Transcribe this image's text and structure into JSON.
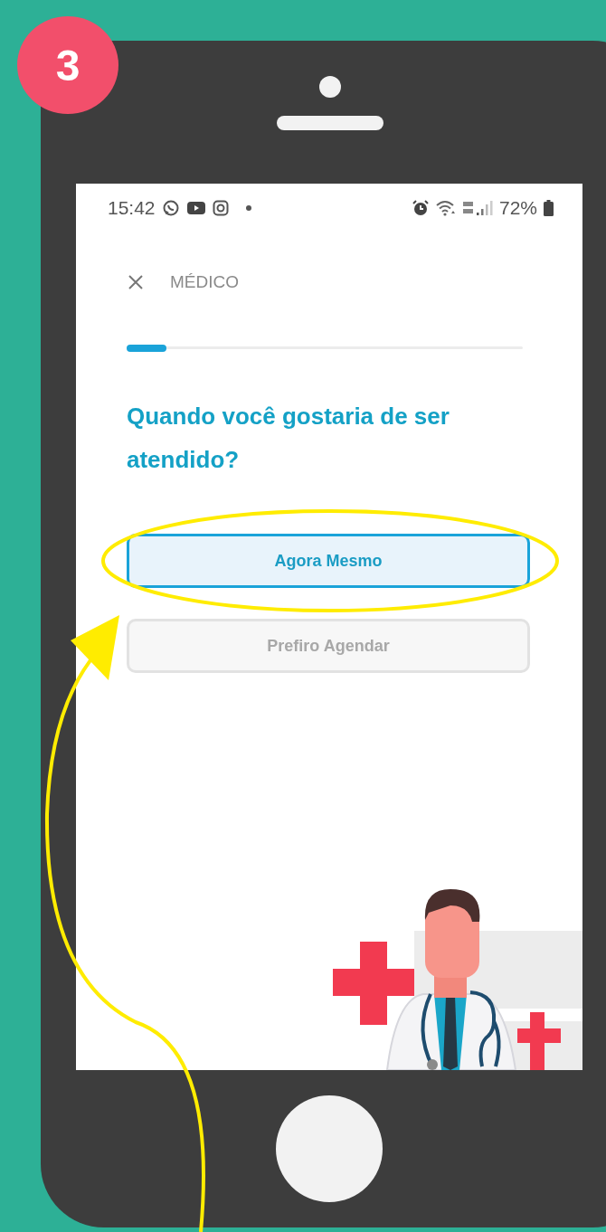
{
  "step_badge": "3",
  "status_bar": {
    "time": "15:42",
    "battery": "72%"
  },
  "header": {
    "title": "MÉDICO"
  },
  "progress": {
    "level": 0.1
  },
  "question": "Quando você gostaria de ser atendido?",
  "options": [
    {
      "label": "Agora Mesmo",
      "selected": true,
      "circled": true
    },
    {
      "label": "Prefiro Agendar",
      "selected": false,
      "circled": false
    }
  ]
}
